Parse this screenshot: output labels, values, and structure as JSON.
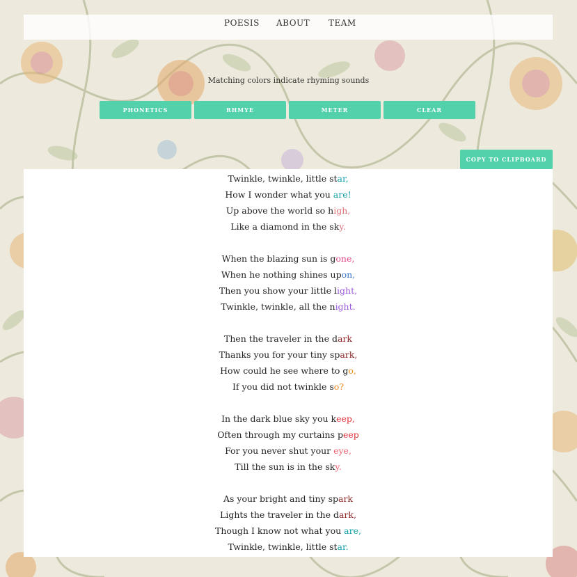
{
  "nav": {
    "items": [
      {
        "label": "POESIS"
      },
      {
        "label": "ABOUT"
      },
      {
        "label": "TEAM"
      }
    ]
  },
  "hint": "Matching colors indicate rhyming sounds",
  "toolbar": {
    "buttons": [
      {
        "label": "PHONETICS"
      },
      {
        "label": "RHMYE"
      },
      {
        "label": "METER"
      },
      {
        "label": "CLEAR"
      }
    ],
    "copy_label": "COPY TO CLIPBOARD"
  },
  "colors": {
    "accent": "#52d1ab",
    "teal": "#14a1a6",
    "salmon": "#e0727a",
    "pink": "#e04a8a",
    "blue": "#3a79c6",
    "purple": "#9a5bd8",
    "brown": "#8b2a2a",
    "orange": "#f08a1e",
    "red": "#e0303a",
    "rose": "#ef5f6f"
  },
  "poem": {
    "stanzas": [
      [
        {
          "pre": "Twinkle, twinkle, little st",
          "rhyme": "ar,",
          "color": "teal"
        },
        {
          "pre": "How I wonder what you ",
          "rhyme": "are!",
          "color": "teal"
        },
        {
          "pre": "Up above the world so h",
          "rhyme": "igh,",
          "color": "salmon"
        },
        {
          "pre": "Like a diamond in the sk",
          "rhyme": "y.",
          "color": "salmon"
        }
      ],
      [
        {
          "pre": "When the blazing sun is g",
          "rhyme": "one,",
          "color": "pink"
        },
        {
          "pre": "When he nothing shines up",
          "rhyme": "on,",
          "color": "blue"
        },
        {
          "pre": "Then you show your little l",
          "rhyme": "ight,",
          "color": "purple"
        },
        {
          "pre": "Twinkle, twinkle, all the n",
          "rhyme": "ight.",
          "color": "purple"
        }
      ],
      [
        {
          "pre": "Then the traveler in the d",
          "rhyme": "ark",
          "color": "brown"
        },
        {
          "pre": "Thanks you for your tiny sp",
          "rhyme": "ark,",
          "color": "brown"
        },
        {
          "pre": "How could he see where to g",
          "rhyme": "o,",
          "color": "orange"
        },
        {
          "pre": "If you did not twinkle s",
          "rhyme": "o?",
          "color": "orange"
        }
      ],
      [
        {
          "pre": "In the dark blue sky you k",
          "rhyme": "eep,",
          "color": "red"
        },
        {
          "pre": "Often through my curtains p",
          "rhyme": "eep",
          "color": "red"
        },
        {
          "pre": "For you never shut your ",
          "rhyme": "eye,",
          "color": "rose"
        },
        {
          "pre": "Till the sun is in the sk",
          "rhyme": "y.",
          "color": "rose"
        }
      ],
      [
        {
          "pre": "As your bright and tiny sp",
          "rhyme": "ark",
          "color": "brown"
        },
        {
          "pre": "Lights the traveler in the d",
          "rhyme": "ark,",
          "color": "brown"
        },
        {
          "pre": "Though I know not what you ",
          "rhyme": "are,",
          "color": "teal"
        },
        {
          "pre": "Twinkle, twinkle, little st",
          "rhyme": "ar.",
          "color": "teal"
        }
      ]
    ]
  }
}
